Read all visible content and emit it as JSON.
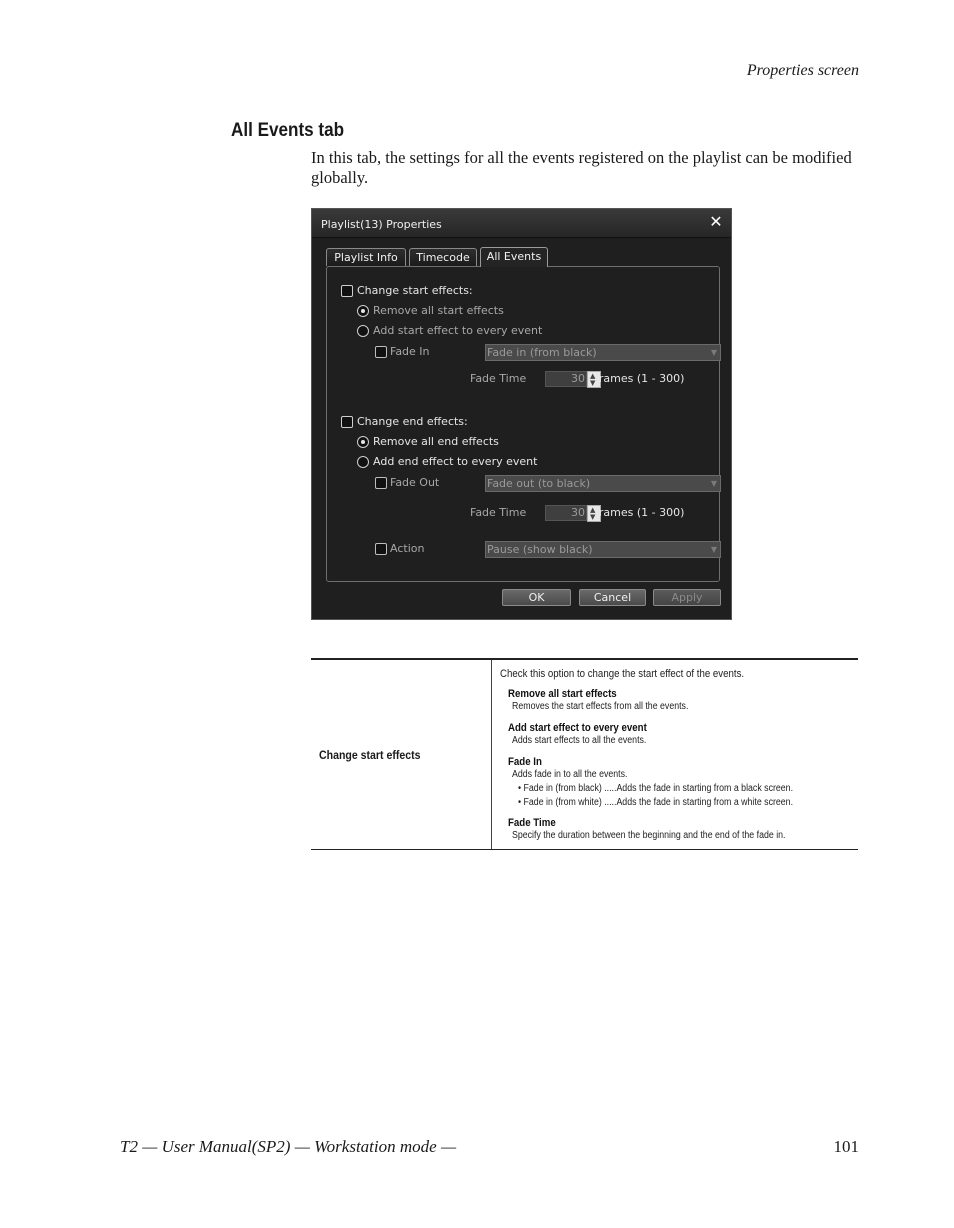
{
  "page": {
    "header": "Properties screen",
    "section_title": "All Events tab",
    "intro": "In this tab, the settings for all the events registered on the playlist can be modified globally.",
    "footer_left": "T2  —  User Manual(SP2)  —  Workstation mode  —",
    "footer_right": "101"
  },
  "dialog": {
    "title": "Playlist(13) Properties",
    "close_glyph": "✕",
    "tabs": [
      {
        "label": "Playlist Info",
        "active": false
      },
      {
        "label": "Timecode",
        "active": false
      },
      {
        "label": "All Events",
        "active": true
      }
    ],
    "start": {
      "checkbox_label": "Change start effects:",
      "radio_remove": "Remove all start effects",
      "radio_add": "Add start effect to every event",
      "fade_label": "Fade In",
      "fade_select": "Fade in (from black)",
      "fade_time_label": "Fade Time",
      "fade_time_value": "30",
      "frames_label": "frames (1 - 300)"
    },
    "end": {
      "checkbox_label": "Change end effects:",
      "radio_remove": "Remove all end effects",
      "radio_add": "Add end effect to every event",
      "fade_label": "Fade Out",
      "fade_select": "Fade out (to black)",
      "fade_time_label": "Fade Time",
      "fade_time_value": "30",
      "frames_label": "frames (1 - 300)",
      "action_label": "Action",
      "action_select": "Pause (show black)"
    },
    "buttons": {
      "ok": "OK",
      "cancel": "Cancel",
      "apply": "Apply"
    }
  },
  "table": {
    "term": "Change start effects",
    "intro": "Check this option to change the start effect of the events.",
    "items": [
      {
        "title": "Remove all start effects",
        "desc": "Removes the start effects from all the events."
      },
      {
        "title": "Add start effect to every event",
        "desc": "Adds start effects to all the events."
      },
      {
        "title": "Fade In",
        "desc": "Adds fade in to all the events.",
        "bullets": [
          "• Fade in (from black) .....Adds the fade in starting from a black screen.",
          "• Fade in (from white) .....Adds the fade in starting from a white screen."
        ]
      },
      {
        "title": "Fade Time",
        "desc": "Specify the duration between the beginning and the end of the fade in."
      }
    ]
  }
}
